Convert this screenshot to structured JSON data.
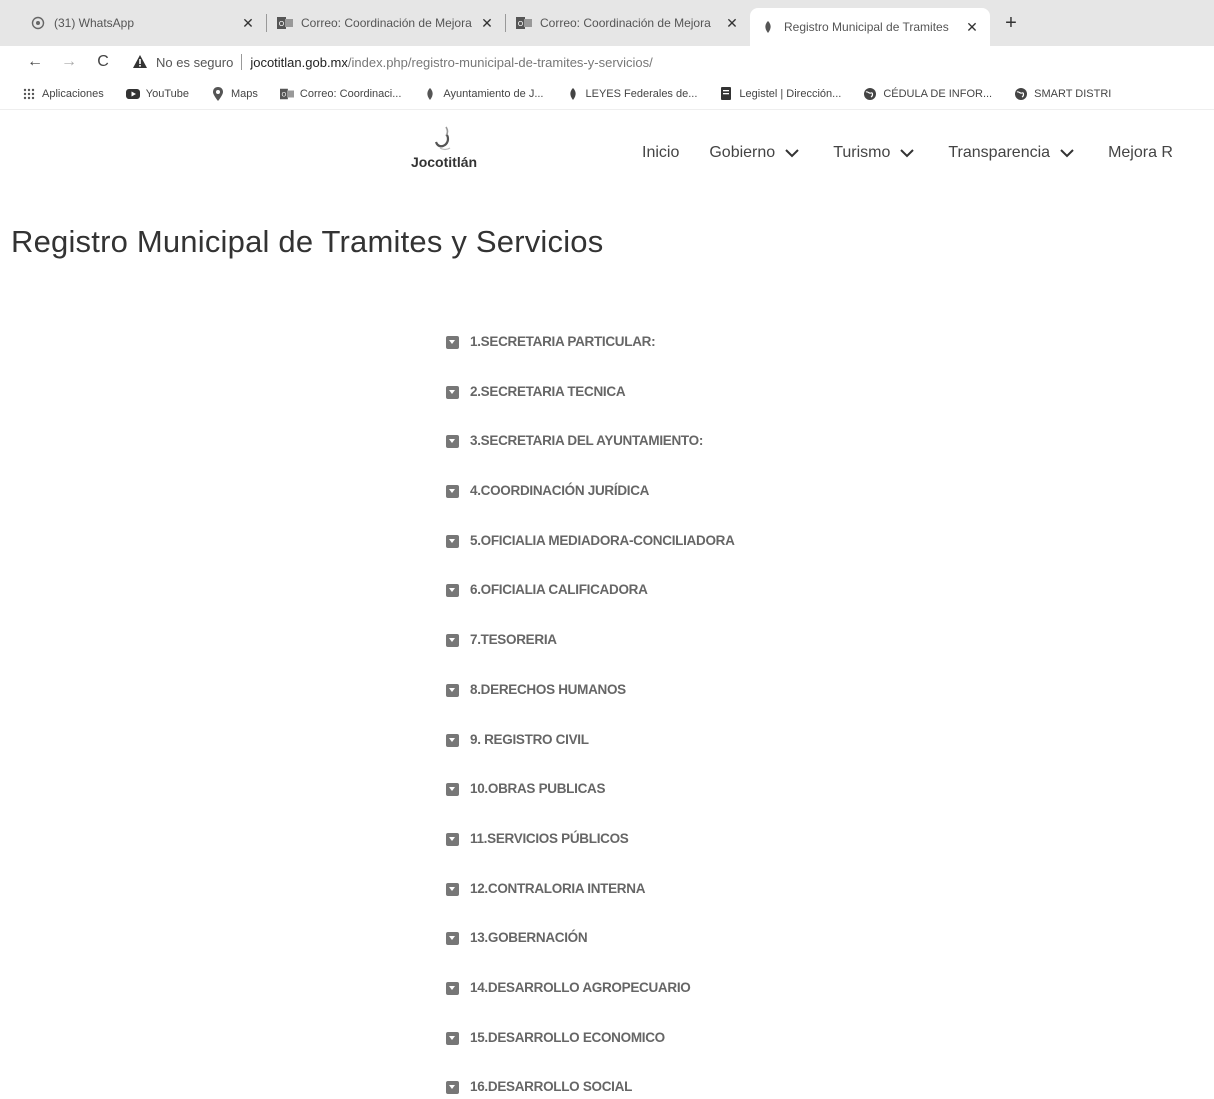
{
  "browser": {
    "tabs": [
      {
        "title": "(31) WhatsApp",
        "icon": "whatsapp-icon",
        "close": "✕",
        "active": false
      },
      {
        "title": "Correo: Coordinación de Mejora",
        "icon": "outlook-icon",
        "close": "✕",
        "active": false
      },
      {
        "title": "Correo: Coordinación de Mejora",
        "icon": "outlook-icon",
        "close": "✕",
        "active": false
      },
      {
        "title": "Registro Municipal de Tramites",
        "icon": "site-icon",
        "close": "✕",
        "active": true
      }
    ],
    "new_tab_label": "+",
    "back": "←",
    "forward": "→",
    "reload": "C",
    "security_label": "No es seguro",
    "url_host": "jocotitlan.gob.mx",
    "url_path": "/index.php/registro-municipal-de-tramites-y-servicios/",
    "bookmarks": [
      {
        "label": "Aplicaciones",
        "icon": "apps-grid-icon"
      },
      {
        "label": "YouTube",
        "icon": "youtube-icon"
      },
      {
        "label": "Maps",
        "icon": "maps-pin-icon"
      },
      {
        "label": "Correo: Coordinaci...",
        "icon": "outlook-icon"
      },
      {
        "label": "Ayuntamiento de J...",
        "icon": "site-icon"
      },
      {
        "label": "LEYES Federales de...",
        "icon": "site-icon"
      },
      {
        "label": "Legistel | Dirección...",
        "icon": "bookmark-icon"
      },
      {
        "label": "CÉDULA DE INFOR...",
        "icon": "globe-icon"
      },
      {
        "label": "SMART DISTRI",
        "icon": "globe-icon"
      }
    ]
  },
  "site": {
    "logo_text": "Jocotitlán",
    "nav": [
      {
        "label": "Inicio",
        "has_dropdown": false
      },
      {
        "label": "Gobierno",
        "has_dropdown": true
      },
      {
        "label": "Turismo",
        "has_dropdown": true
      },
      {
        "label": "Transparencia",
        "has_dropdown": true
      },
      {
        "label": "Mejora R",
        "has_dropdown": false
      }
    ]
  },
  "page": {
    "title": "Registro Municipal de Tramites y Servicios",
    "departments": [
      "1.SECRETARIA PARTICULAR:",
      "2.SECRETARIA TECNICA",
      "3.SECRETARIA DEL AYUNTAMIENTO:",
      "4.COORDINACIÓN JURÍDICA",
      "5.OFICIALIA MEDIADORA-CONCILIADORA",
      "6.OFICIALIA CALIFICADORA",
      "7.TESORERIA",
      "8.DERECHOS HUMANOS",
      "9. REGISTRO CIVIL",
      "10.OBRAS PUBLICAS",
      "11.SERVICIOS PÚBLICOS",
      "12.CONTRALORIA INTERNA",
      "13.GOBERNACIÓN",
      "14.DESARROLLO AGROPECUARIO",
      "15.DESARROLLO ECONOMICO",
      "16.DESARROLLO SOCIAL"
    ]
  }
}
